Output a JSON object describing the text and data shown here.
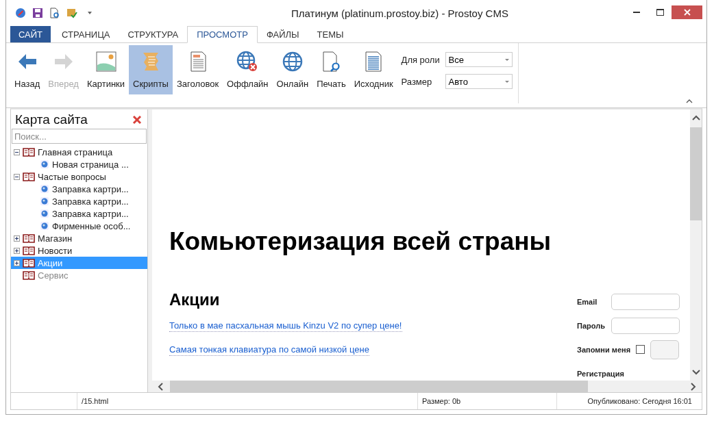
{
  "window": {
    "title": "Платинум (platinum.prostoy.biz) - Prostoy CMS"
  },
  "tabs": [
    {
      "label": "САЙТ",
      "kind": "app",
      "selected": false
    },
    {
      "label": "СТРАНИЦА",
      "kind": "tab",
      "selected": false
    },
    {
      "label": "СТРУКТУРА",
      "kind": "tab",
      "selected": false
    },
    {
      "label": "ПРОСМОТР",
      "kind": "tab",
      "selected": true
    },
    {
      "label": "ФАЙЛЫ",
      "kind": "tab",
      "selected": false
    },
    {
      "label": "ТЕМЫ",
      "kind": "tab",
      "selected": false
    }
  ],
  "toolbar": {
    "buttons": [
      {
        "label": "Назад",
        "disabled": false,
        "selected": false
      },
      {
        "label": "Вперед",
        "disabled": true,
        "selected": false
      },
      {
        "label": "Картинки",
        "disabled": false,
        "selected": false
      },
      {
        "label": "Скрипты",
        "disabled": false,
        "selected": true
      },
      {
        "label": "Заголовок",
        "disabled": false,
        "selected": false
      },
      {
        "label": "Оффлайн",
        "disabled": false,
        "selected": false
      },
      {
        "label": "Онлайн",
        "disabled": false,
        "selected": false
      },
      {
        "label": "Печать",
        "disabled": false,
        "selected": false
      },
      {
        "label": "Исходник",
        "disabled": false,
        "selected": false
      }
    ],
    "fields": [
      {
        "label": "Для роли",
        "value": "Все"
      },
      {
        "label": "Размер",
        "value": "Авто"
      }
    ]
  },
  "sidebar": {
    "title": "Карта сайта",
    "search": {
      "placeholder": "Поиск..."
    },
    "tree": [
      {
        "label": "Главная страница",
        "kind": "section",
        "expanded": true,
        "selected": false,
        "disabled": false,
        "children": [
          {
            "label": "Новая страница ...",
            "kind": "page",
            "selected": false,
            "disabled": false
          }
        ]
      },
      {
        "label": "Частые вопросы",
        "kind": "section",
        "expanded": true,
        "selected": false,
        "disabled": false,
        "children": [
          {
            "label": "Заправка картри...",
            "kind": "page",
            "selected": false,
            "disabled": false
          },
          {
            "label": "Заправка картри...",
            "kind": "page",
            "selected": false,
            "disabled": false
          },
          {
            "label": "Заправка картри...",
            "kind": "page",
            "selected": false,
            "disabled": false
          },
          {
            "label": "Фирменные особ...",
            "kind": "page",
            "selected": false,
            "disabled": false
          }
        ]
      },
      {
        "label": "Магазин",
        "kind": "section",
        "expanded": false,
        "selected": false,
        "disabled": false
      },
      {
        "label": "Новости",
        "kind": "section",
        "expanded": false,
        "selected": false,
        "disabled": false
      },
      {
        "label": "Акции",
        "kind": "section",
        "expanded": false,
        "selected": true,
        "disabled": false
      },
      {
        "label": "Сервис",
        "kind": "leaf",
        "selected": false,
        "disabled": true
      }
    ]
  },
  "preview": {
    "heading": "Комьютеризация всей страны",
    "subheading": "Акции",
    "links": [
      "Только в мае пасхальная мышь Kinzu V2 по супер цене!",
      "Самая тонкая клавиатура по самой низкой цене"
    ],
    "login": {
      "email_label": "Email",
      "password_label": "Пароль",
      "remember_label": "Запомни меня",
      "remember_checked": false,
      "register_label": "Регистрация"
    }
  },
  "status_bar": [
    "/15.html",
    "Размер: 0b",
    "Опубликовано: Сегодня 16:01"
  ]
}
